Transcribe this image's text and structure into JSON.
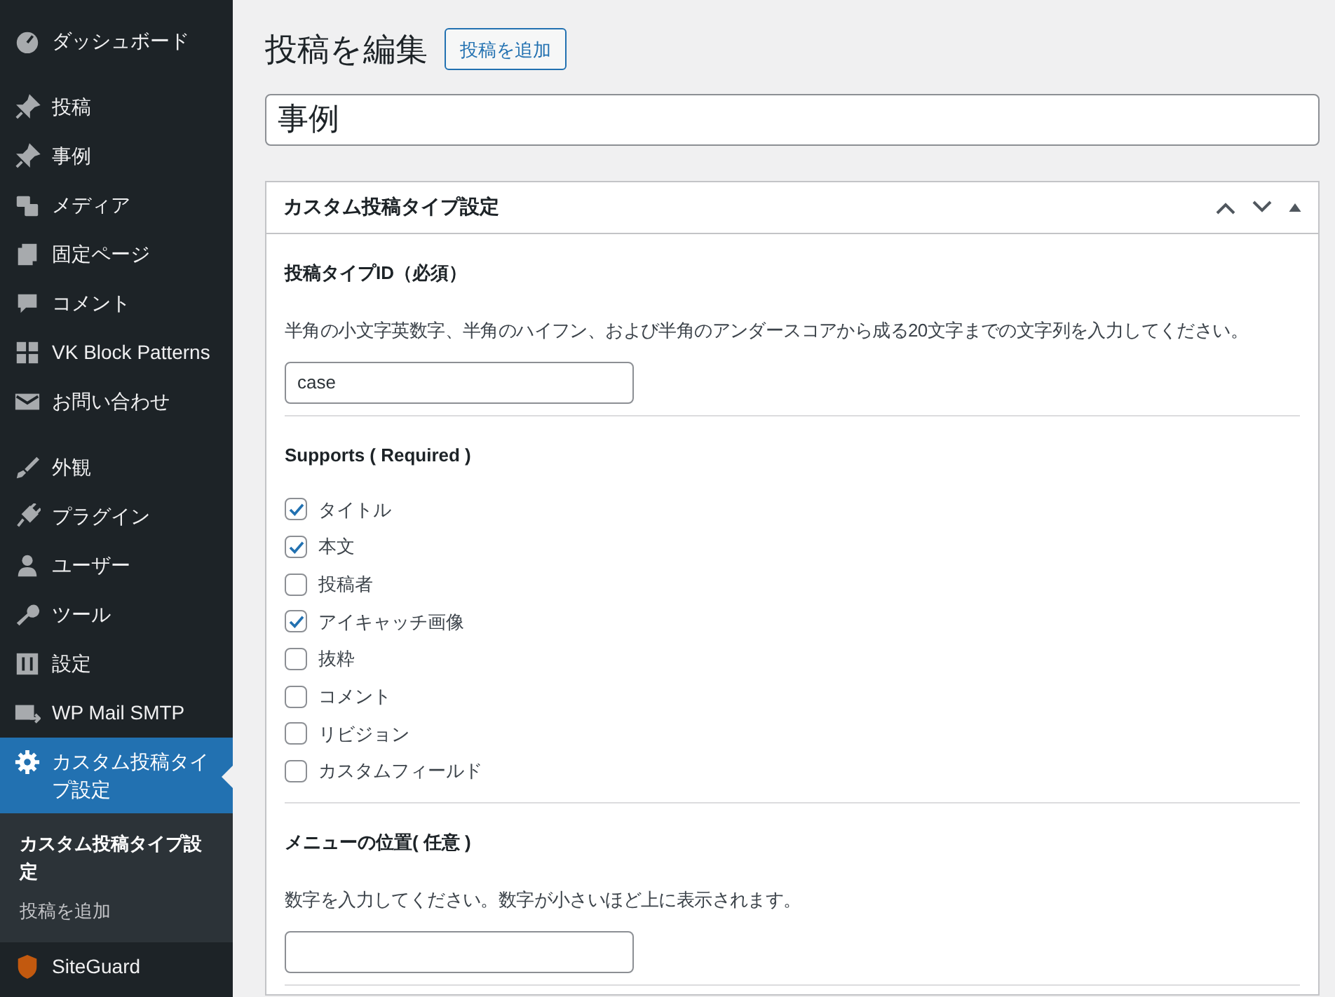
{
  "sidebar": {
    "groups": [
      [
        {
          "label": "ダッシュボード",
          "selected": false
        }
      ],
      [
        {
          "label": "投稿",
          "selected": false
        },
        {
          "label": "事例",
          "selected": false
        },
        {
          "label": "メディア",
          "selected": false
        },
        {
          "label": "固定ページ",
          "selected": false
        },
        {
          "label": "コメント",
          "selected": false
        },
        {
          "label": "VK Block Patterns",
          "selected": false
        },
        {
          "label": "お問い合わせ",
          "selected": false
        }
      ],
      [
        {
          "label": "外観",
          "selected": false
        },
        {
          "label": "プラグイン",
          "selected": false
        },
        {
          "label": "ユーザー",
          "selected": false
        },
        {
          "label": "ツール",
          "selected": false
        },
        {
          "label": "設定",
          "selected": false
        },
        {
          "label": "WP Mail SMTP",
          "selected": false
        },
        {
          "label": "カスタム投稿タイプ設定",
          "selected": true,
          "submenu": [
            {
              "label": "カスタム投稿タイプ設定",
              "selected": true
            },
            {
              "label": "投稿を追加",
              "selected": false
            }
          ]
        },
        {
          "label": "SiteGuard",
          "selected": false
        }
      ]
    ]
  },
  "page": {
    "title": "投稿を編集",
    "add_button": "投稿を追加",
    "post_title": "事例"
  },
  "postbox": {
    "title": "カスタム投稿タイプ設定",
    "sections": [
      {
        "kind": "text",
        "label": "投稿タイプID（必須）",
        "description": "半角の小文字英数字、半角のハイフン、および半角のアンダースコアから成る20文字までの文字列を入力してください。",
        "value": "case"
      },
      {
        "kind": "checks",
        "label": "Supports ( Required )",
        "options": [
          {
            "label": "タイトル",
            "checked": true
          },
          {
            "label": "本文",
            "checked": true
          },
          {
            "label": "投稿者",
            "checked": false
          },
          {
            "label": "アイキャッチ画像",
            "checked": true
          },
          {
            "label": "抜粋",
            "checked": false
          },
          {
            "label": "コメント",
            "checked": false
          },
          {
            "label": "リビジョン",
            "checked": false
          },
          {
            "label": "カスタムフィールド",
            "checked": false
          }
        ]
      },
      {
        "kind": "text",
        "label": "メニューの位置( 任意 )",
        "description": "数字を入力してください。数字が小さいほど上に表示されます。"
      }
    ]
  }
}
